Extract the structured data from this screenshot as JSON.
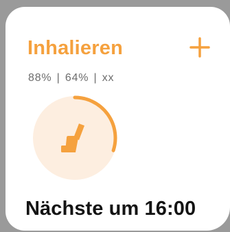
{
  "widget": {
    "title": "Inhalieren",
    "stats": "88% | 64% | xx",
    "next_dose": "Nächste um 16:00",
    "progress_fraction": 0.3,
    "icons": {
      "add": "plus-icon",
      "inhaler": "inhaler-icon"
    },
    "colors": {
      "accent": "#f5a13e",
      "ring_background": "#fdeee0",
      "text_primary": "#141414",
      "text_secondary": "#6d6d6d",
      "card_background": "#ffffff",
      "outer_background": "#9a9a9a"
    }
  }
}
